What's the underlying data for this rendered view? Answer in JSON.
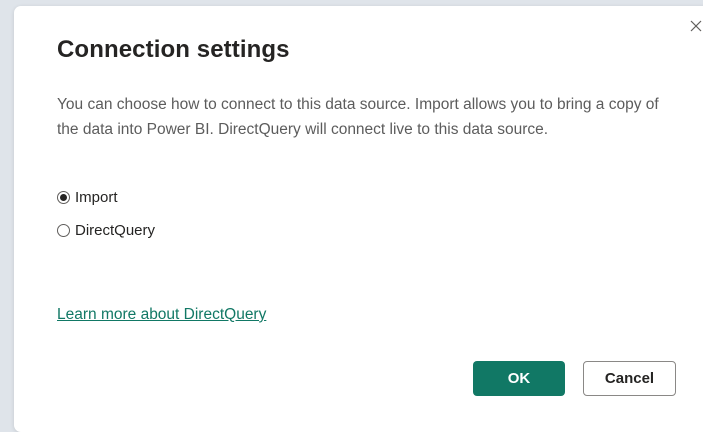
{
  "dialog": {
    "title": "Connection settings",
    "description": "You can choose how to connect to this data source. Import allows you to bring a copy of the data into Power BI. DirectQuery will connect live to this data source.",
    "close_icon": "close-icon",
    "options": [
      {
        "label": "Import",
        "selected": true
      },
      {
        "label": "DirectQuery",
        "selected": false
      }
    ],
    "learn_more_link": "Learn more about DirectQuery",
    "ok_label": "OK",
    "cancel_label": "Cancel"
  },
  "colors": {
    "accent": "#117865",
    "title": "#252423",
    "body_text": "#5c5c5c",
    "backdrop": "#dfe4ea"
  }
}
